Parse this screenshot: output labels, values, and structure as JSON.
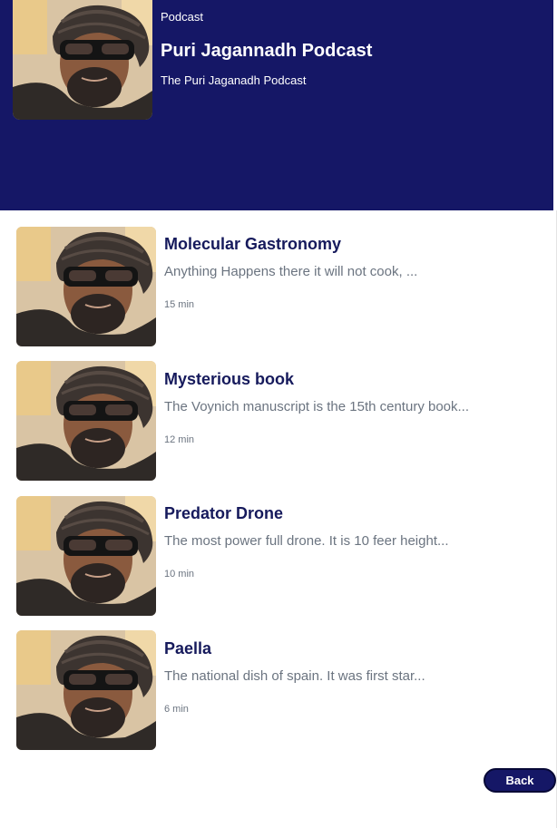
{
  "header": {
    "kicker": "Podcast",
    "title": "Puri Jagannadh Podcast",
    "subtitle": "The Puri Jaganadh Podcast",
    "cover_image": "podcast-host-portrait",
    "background_color": "#151766"
  },
  "episodes": [
    {
      "title": "Molecular Gastronomy",
      "description": "Anything Happens there it will not cook, ...",
      "duration": "15 min",
      "thumbnail": "podcast-host-portrait"
    },
    {
      "title": "Mysterious book",
      "description": "The Voynich manuscript is the 15th century book...",
      "duration": "12 min",
      "thumbnail": "podcast-host-portrait"
    },
    {
      "title": "Predator Drone",
      "description": "The most power full drone. It is 10 feer height...",
      "duration": "10 min",
      "thumbnail": "podcast-host-portrait"
    },
    {
      "title": "Paella",
      "description": "The national dish of spain. It was first star...",
      "duration": "6 min",
      "thumbnail": "podcast-host-portrait"
    }
  ],
  "back_button": {
    "label": "Back"
  },
  "colors": {
    "accent": "#151766",
    "title_text": "#161a5c",
    "muted_text": "#6b7480"
  }
}
